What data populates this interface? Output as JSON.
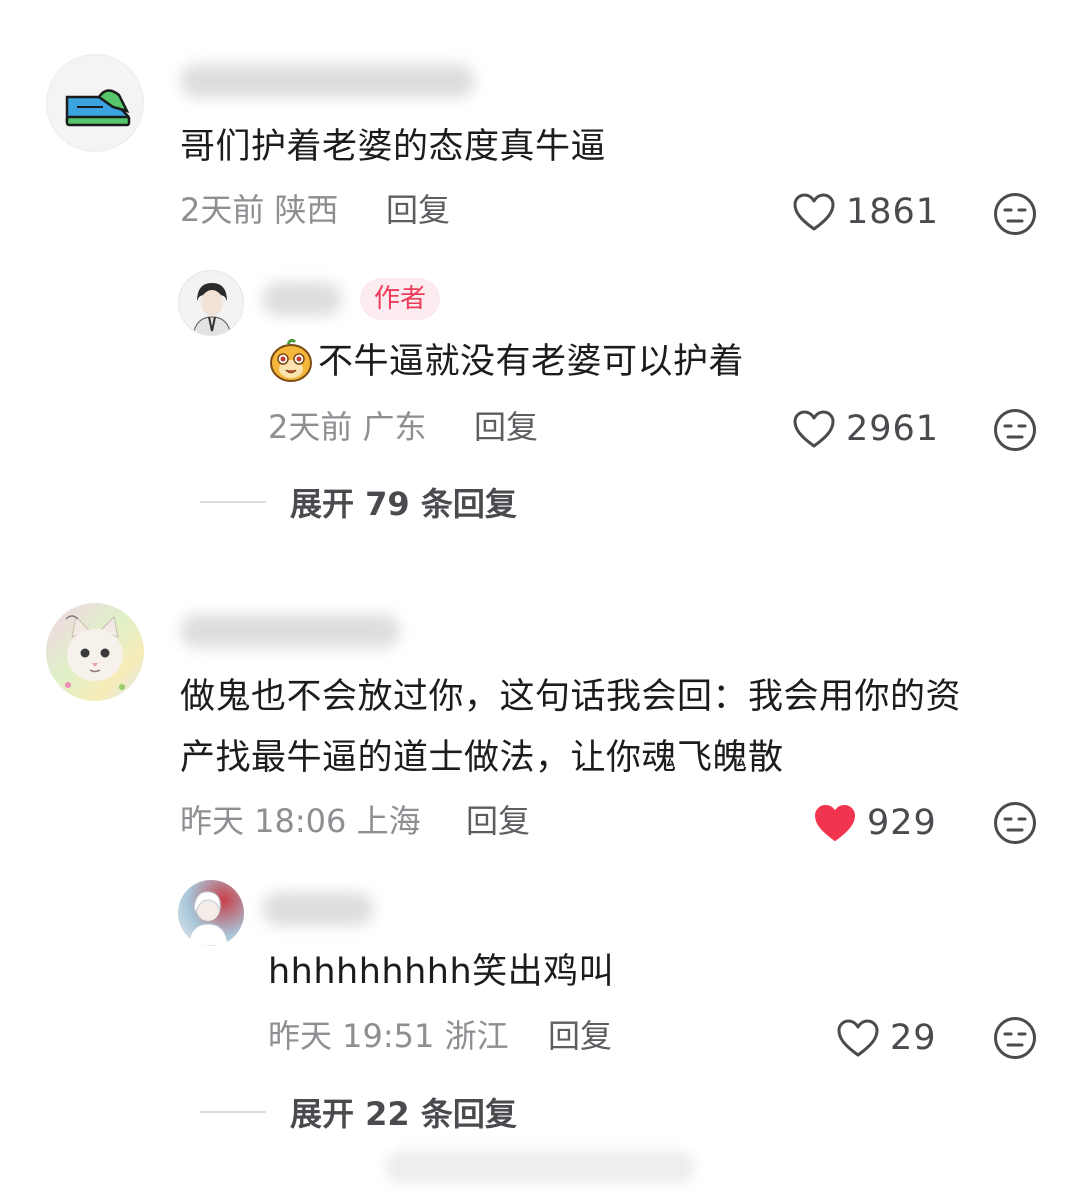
{
  "comments": [
    {
      "text": "哥们护着老婆的态度真牛逼",
      "meta": "2天前 陕西",
      "reply_label": "回复",
      "likes": "1861",
      "liked": false,
      "avatar_icon": "sneaker-icon",
      "reply": {
        "badge": "作者",
        "emoji_icon": "cute-dog-emoji-icon",
        "text": "不牛逼就没有老婆可以护着",
        "meta": "2天前 广东",
        "reply_label": "回复",
        "likes": "2961",
        "liked": false
      },
      "expand_label": "展开 79 条回复"
    },
    {
      "text_line1": "做鬼也不会放过你，这句话我会回：我会用你的资",
      "text_line2": "产找最牛逼的道士做法，让你魂飞魄散",
      "meta": "昨天 18:06 上海",
      "reply_label": "回复",
      "likes": "929",
      "liked": true,
      "avatar_icon": "white-cat-avatar",
      "reply": {
        "text": "hhhhhhhhh笑出鸡叫",
        "meta": "昨天 19:51 浙江",
        "reply_label": "回复",
        "likes": "29",
        "liked": false
      },
      "expand_label": "展开 22 条回复"
    }
  ],
  "colors": {
    "liked_heart": "#f2354f",
    "badge_text": "#ef3b5a",
    "badge_bg": "#fdecef",
    "meta_text": "#8e8e93"
  }
}
